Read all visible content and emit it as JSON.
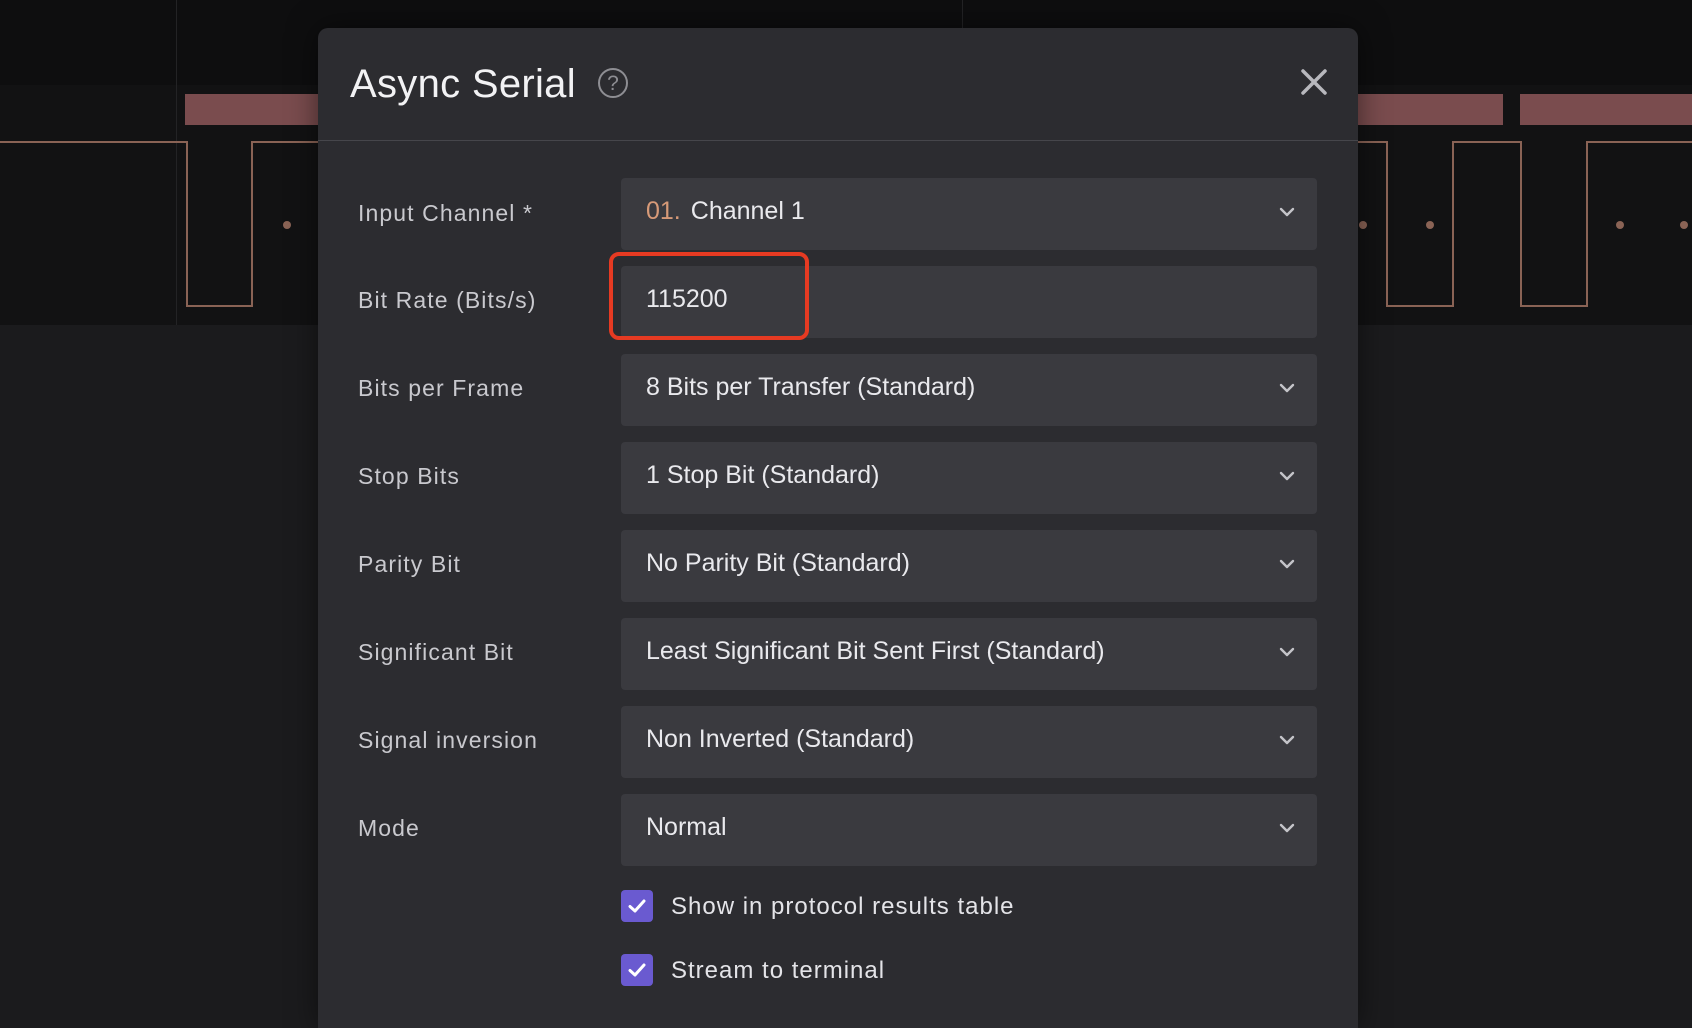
{
  "dialog": {
    "title": "Async Serial",
    "help_icon": "question-circle-icon",
    "close_icon": "close-icon"
  },
  "fields": {
    "input_channel": {
      "label": "Input Channel *",
      "number": "01.",
      "value": "Channel 1"
    },
    "bit_rate": {
      "label": "Bit Rate (Bits/s)",
      "value": "115200"
    },
    "bits_per_frame": {
      "label": "Bits per Frame",
      "value": "8 Bits per Transfer (Standard)"
    },
    "stop_bits": {
      "label": "Stop Bits",
      "value": "1 Stop Bit (Standard)"
    },
    "parity_bit": {
      "label": "Parity Bit",
      "value": "No Parity Bit (Standard)"
    },
    "significant_bit": {
      "label": "Significant Bit",
      "value": "Least Significant Bit Sent First (Standard)"
    },
    "signal_inversion": {
      "label": "Signal inversion",
      "value": "Non Inverted (Standard)"
    },
    "mode": {
      "label": "Mode",
      "value": "Normal"
    }
  },
  "checkboxes": {
    "show_in_table": {
      "label": "Show in protocol results table",
      "checked": true
    },
    "stream_to_terminal": {
      "label": "Stream to terminal",
      "checked": true
    }
  },
  "colors": {
    "accent": "#6a5ad0",
    "highlight": "#e63a22",
    "channel_number": "#d79a78",
    "waveform": "#8a6355",
    "packet_bar": "#7a4c4e"
  }
}
